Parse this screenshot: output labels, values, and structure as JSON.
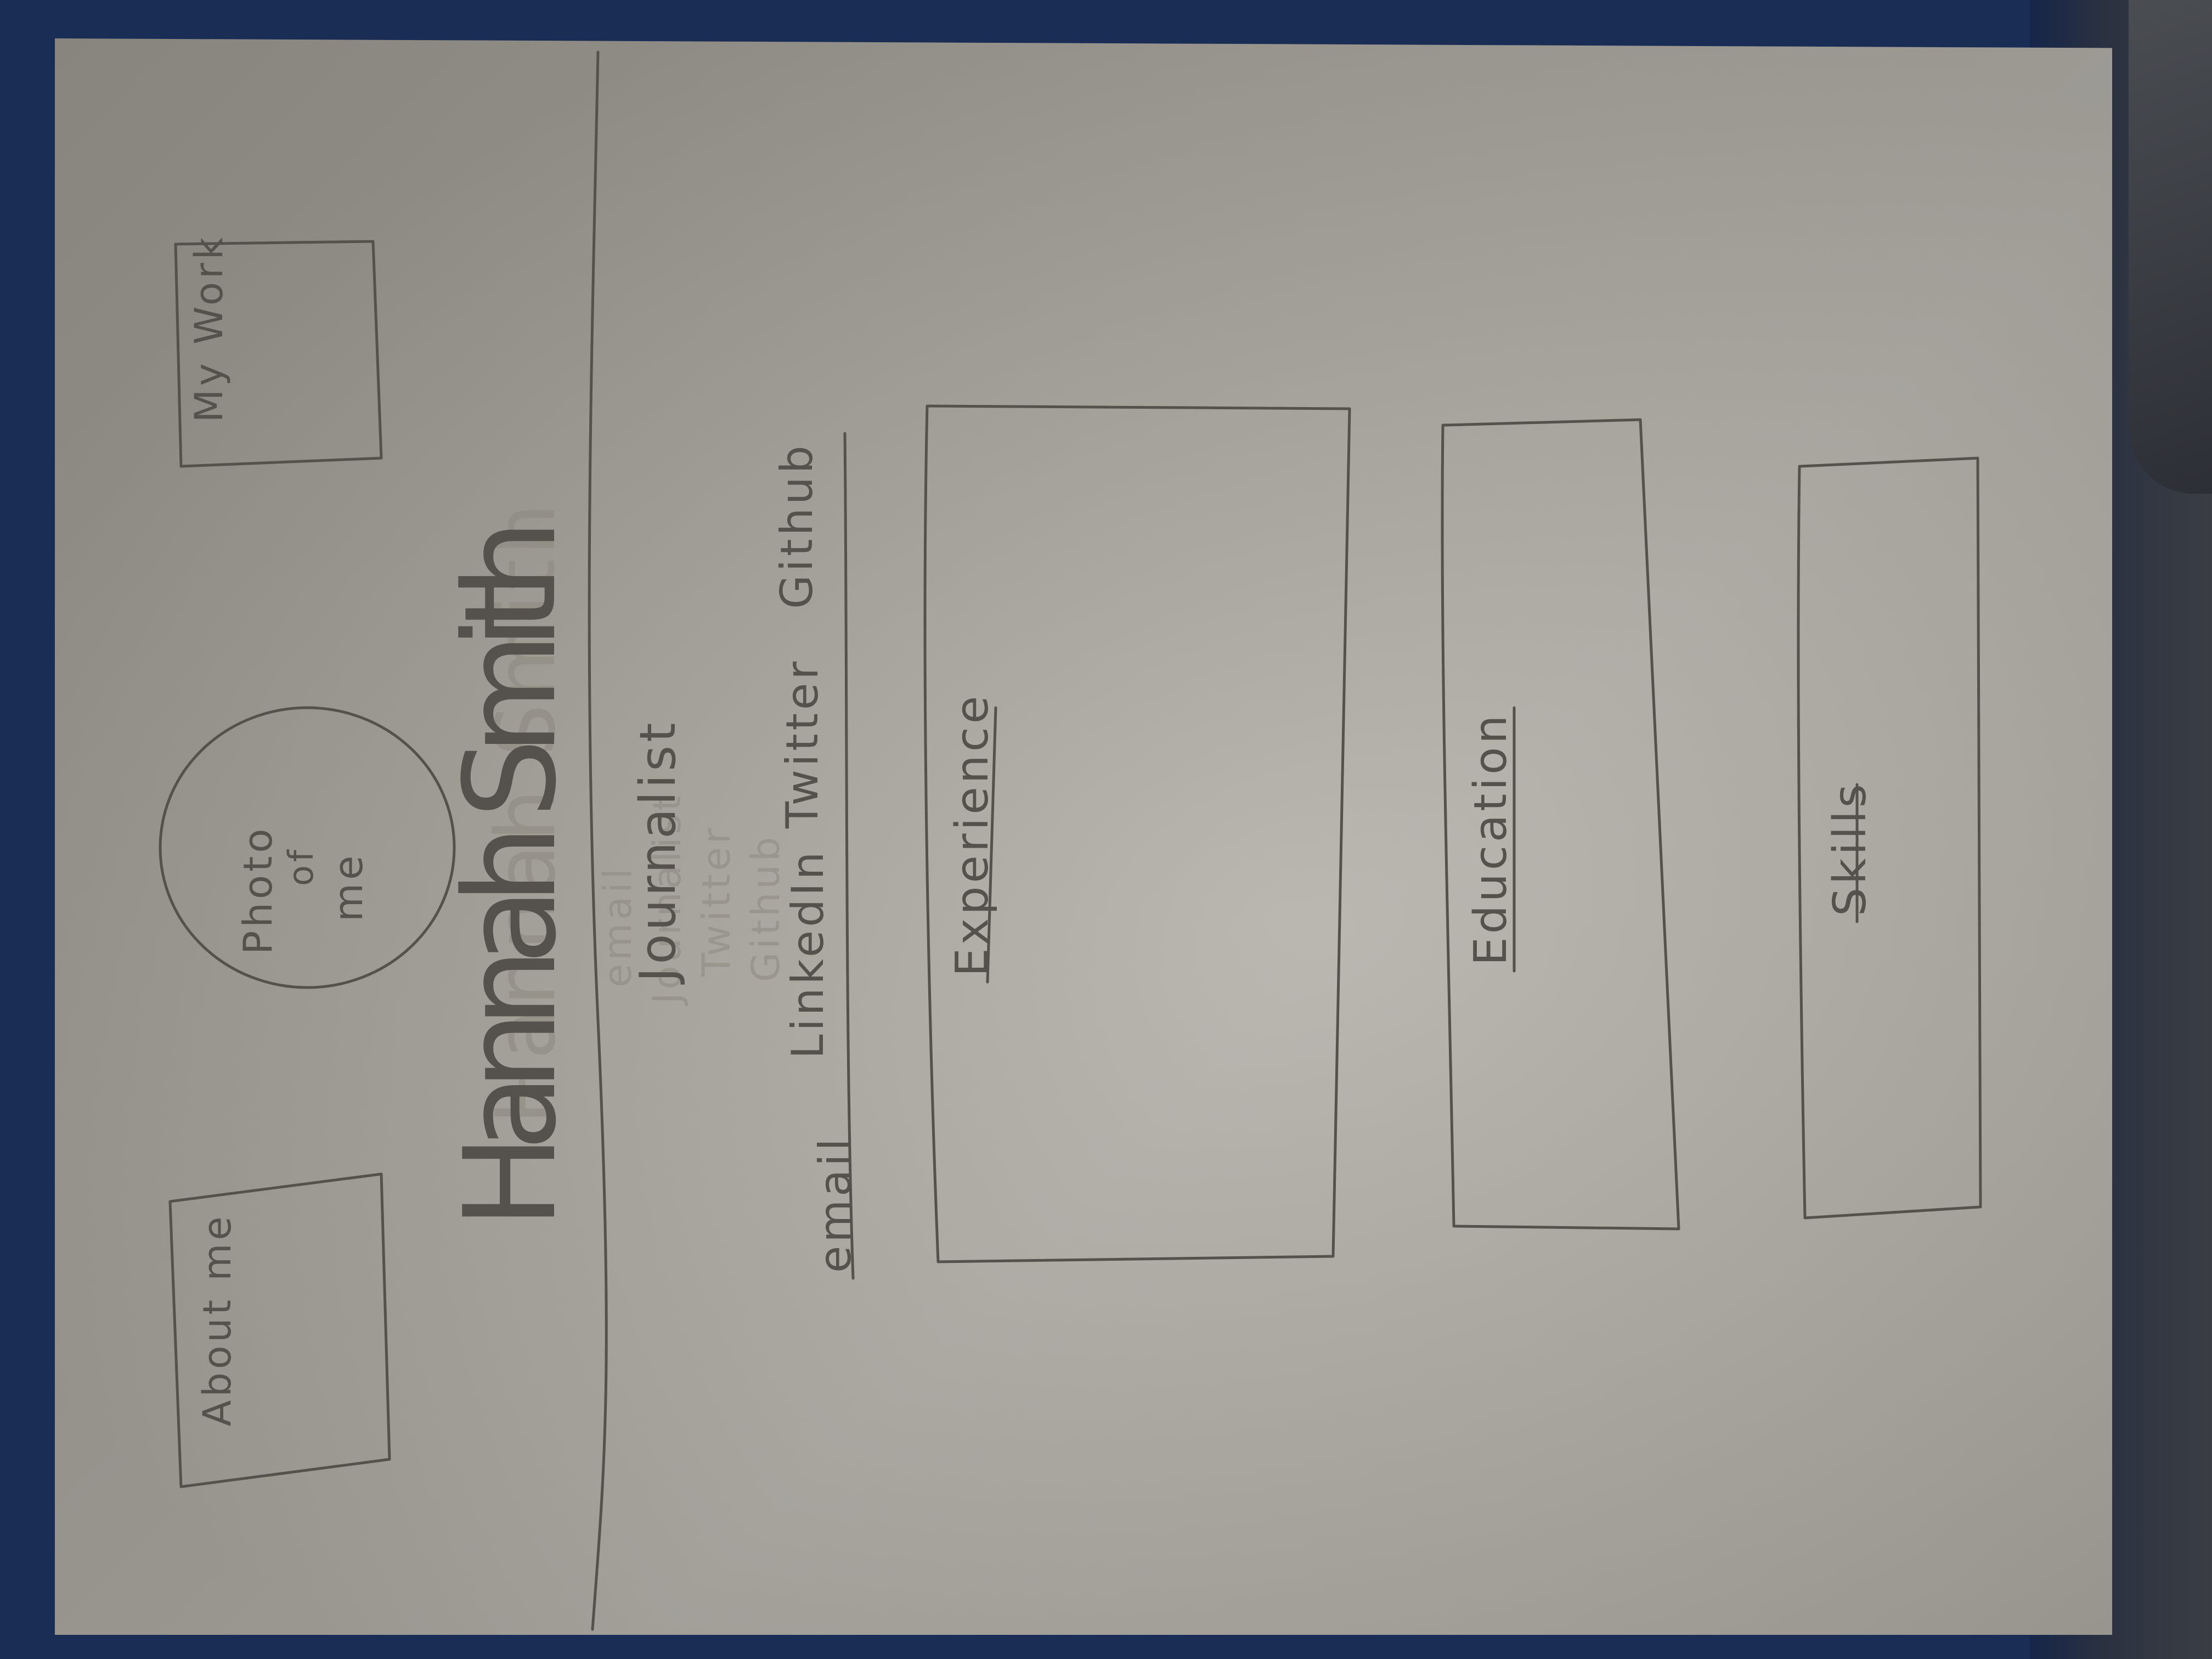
{
  "nav": {
    "about_label": "About me",
    "work_label": "My Work"
  },
  "profile": {
    "photo_label_lines": [
      "Photo",
      "of",
      "me"
    ],
    "name": "Hannah Smith",
    "title": "Journalist",
    "ghost_lines": [
      "Hannah Smith",
      "email",
      "Journalist",
      "Twitter",
      "Github"
    ]
  },
  "links": {
    "email": "email",
    "linkedin": "LinkedIn",
    "twitter": "Twitter",
    "github": "Github"
  },
  "sections": {
    "experience": "Experience",
    "education": "Education",
    "skills": "Skills"
  },
  "colors": {
    "pencil": "#55524d",
    "paper": "#a9a59e",
    "backdrop": "#1a2d55"
  }
}
